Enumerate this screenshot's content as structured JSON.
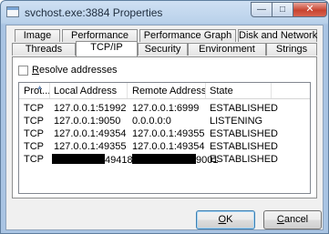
{
  "window": {
    "title": "svchost.exe:3884 Properties",
    "min_glyph": "—",
    "max_glyph": "□",
    "close_glyph": "✕"
  },
  "tabs": {
    "row1": [
      "Image",
      "Performance",
      "Performance Graph",
      "Disk and Network"
    ],
    "row2": [
      "Threads",
      "TCP/IP",
      "Security",
      "Environment",
      "Strings"
    ],
    "active": "TCP/IP"
  },
  "options": {
    "resolve_prefix": "R",
    "resolve_rest": "esolve addresses",
    "resolve_checked": false
  },
  "table": {
    "columns": [
      "Prot...",
      "Local Address",
      "Remote Address",
      "State"
    ],
    "rows": [
      {
        "proto": "TCP",
        "local": "127.0.0.1:51992",
        "remote": "127.0.0.1:6999",
        "state": "ESTABLISHED"
      },
      {
        "proto": "TCP",
        "local": "127.0.0.1:9050",
        "remote": "0.0.0.0:0",
        "state": "LISTENING"
      },
      {
        "proto": "TCP",
        "local": "127.0.0.1:49354",
        "remote": "127.0.0.1:49355",
        "state": "ESTABLISHED"
      },
      {
        "proto": "TCP",
        "local": "127.0.0.1:49355",
        "remote": "127.0.0.1:49354",
        "state": "ESTABLISHED"
      },
      {
        "proto": "TCP",
        "local_suffix": "49418",
        "remote_suffix": "9001",
        "state": "ESTABLISHED"
      }
    ]
  },
  "buttons": {
    "ok_prefix": "O",
    "ok_rest": "K",
    "cancel_prefix": "C",
    "cancel_rest": "ancel"
  }
}
